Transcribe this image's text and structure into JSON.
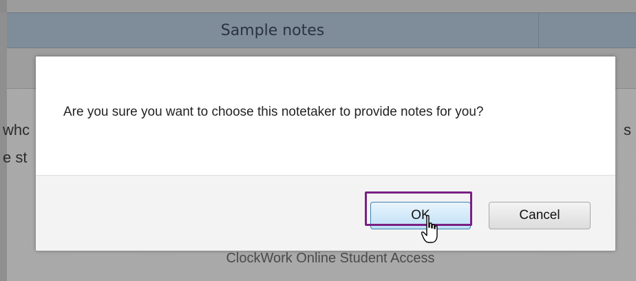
{
  "header": {
    "title": "Sample notes"
  },
  "background": {
    "left_fragment_1": "whc",
    "left_fragment_2": "e st",
    "right_fragment_1": "s",
    "footer": "ClockWork Online Student Access"
  },
  "dialog": {
    "message": "Are you sure you want to choose this notetaker to provide notes for you?",
    "ok_label": "OK",
    "cancel_label": "Cancel"
  },
  "colors": {
    "header_bg": "#7f8c99",
    "highlight": "#7a1f82",
    "ok_border": "#3c7fb1"
  },
  "icons": {
    "cursor": "hand-pointer-icon"
  }
}
